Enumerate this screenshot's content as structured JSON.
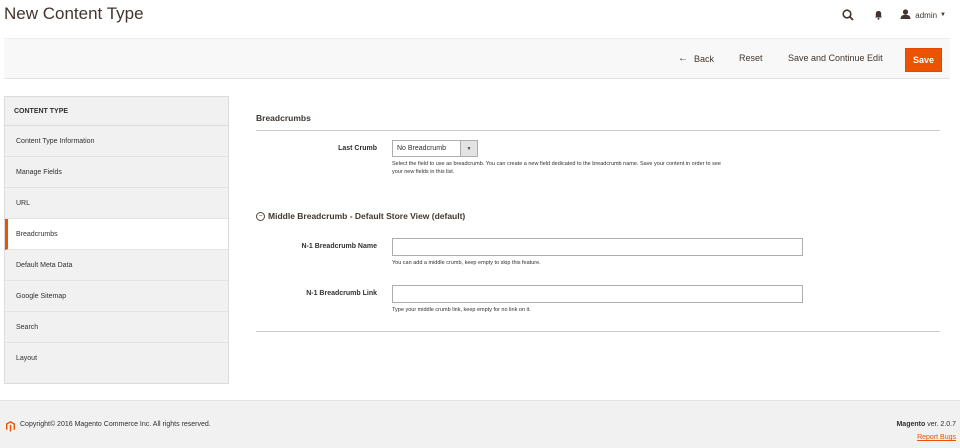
{
  "header": {
    "title": "New Content Type",
    "user_name": "admin",
    "icons": [
      "search-icon",
      "bell-icon",
      "user-icon"
    ]
  },
  "actions": {
    "back_label": "Back",
    "reset_label": "Reset",
    "save_continue_label": "Save and Continue Edit",
    "save_label": "Save"
  },
  "sidebar": {
    "heading": "CONTENT TYPE",
    "items": [
      {
        "label": "Content Type Information"
      },
      {
        "label": "Manage Fields"
      },
      {
        "label": "URL"
      },
      {
        "label": "Breadcrumbs",
        "active": true
      },
      {
        "label": "Default Meta Data"
      },
      {
        "label": "Google Sitemap"
      },
      {
        "label": "Search"
      },
      {
        "label": "Layout"
      }
    ]
  },
  "main": {
    "section_title": "Breadcrumbs",
    "last_crumb": {
      "label": "Last Crumb",
      "value": "No Breadcrumb",
      "note_line1": "Select the field to use as breadcrumb. You can create a new field dedicated to the breadcrumb name. Save your content in order to see",
      "note_line2": "your new fields in this list."
    },
    "middle": {
      "title": "Middle Breadcrumb - Default Store View (default)",
      "name_label": "N-1 Breadcrumb Name",
      "name_value": "",
      "name_note": "You can add a middle crumb, keep empty to skip this feature.",
      "link_label": "N-1 Breadcrumb Link",
      "link_value": "",
      "link_note": "Type your middle crumb link, keep empty for no link on it."
    }
  },
  "footer": {
    "copyright": "Copyright© 2016 Magento Commerce Inc. All rights reserved.",
    "brand": "Magento",
    "version": " ver. 2.0.7",
    "report_bugs": "Report Bugs"
  },
  "colors": {
    "accent": "#eb5202",
    "text": "#303030",
    "sidebar_bg": "#f1f1f1"
  }
}
